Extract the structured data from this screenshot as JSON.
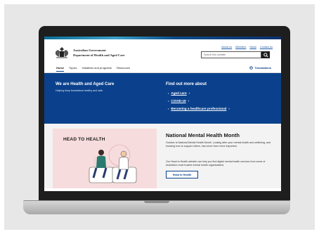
{
  "header": {
    "gov_line1": "Australian Government",
    "gov_line2": "Department of Health and Aged Care",
    "top_links": [
      "About us",
      "Ministers",
      "News",
      "Contact us"
    ],
    "search_placeholder": "Search this website"
  },
  "nav": {
    "items": [
      "Home",
      "Topics",
      "Initiatives and programs",
      "Resources"
    ],
    "active": "Home",
    "translations": "Translations"
  },
  "hero": {
    "title": "We are Health and Aged Care",
    "subtitle": "Helping keep Australians healthy and safe.",
    "more_title": "Find out more about",
    "links": [
      "Aged care",
      "COVID-19",
      "Becoming a healthcare professional"
    ]
  },
  "feature": {
    "image_label": "HEAD TO HEALTH",
    "title": "National Mental Health Month",
    "para1": "October is National Mental Health Month. Looking after your mental health and wellbeing, and knowing how to support others, has never been more important.",
    "para2": "Our Head to Health website can help you find digital mental health services from some of Australia's most trusted mental health organisations.",
    "button": "Head to Health"
  },
  "colors": {
    "brand_blue": "#0b418c",
    "hero_bg": "#0b418c",
    "illustration_bg": "#f7dcdd"
  }
}
